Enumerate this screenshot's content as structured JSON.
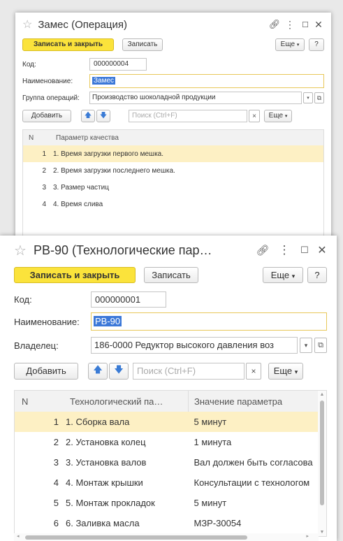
{
  "win1": {
    "title": "Замес (Операция)",
    "save_close": "Записать и закрыть",
    "save": "Записать",
    "more": "Еще",
    "help": "?",
    "code_label": "Код:",
    "code_value": "000000004",
    "name_label": "Наименование:",
    "name_value": "Замес",
    "group_label": "Группа операций:",
    "group_value": "Производство шоколадной продукции",
    "add": "Добавить",
    "search_placeholder": "Поиск (Ctrl+F)",
    "clear": "×",
    "more2": "Еще",
    "col_n": "N",
    "col_param": "Параметр качества",
    "rows": [
      {
        "n": "1",
        "param": "1. Время загрузки первого мешка."
      },
      {
        "n": "2",
        "param": "2. Время загрузки последнего мешка."
      },
      {
        "n": "3",
        "param": "3. Размер частиц"
      },
      {
        "n": "4",
        "param": "4. Время слива"
      }
    ]
  },
  "win2": {
    "title": "РВ-90 (Технологические пар…",
    "save_close": "Записать и закрыть",
    "save": "Записать",
    "more": "Еще",
    "help": "?",
    "code_label": "Код:",
    "code_value": "000000001",
    "name_label": "Наименование:",
    "name_value": "РВ-90",
    "owner_label": "Владелец:",
    "owner_value": "186-0000 Редуктор высокого давления воз",
    "add": "Добавить",
    "search_placeholder": "Поиск (Ctrl+F)",
    "clear": "×",
    "more2": "Еще",
    "col_n": "N",
    "col_param": "Технологический па…",
    "col_value": "Значение параметра",
    "rows": [
      {
        "n": "1",
        "param": "1. Сборка вала",
        "value": "5 минут"
      },
      {
        "n": "2",
        "param": "2. Установка колец",
        "value": "1 минута"
      },
      {
        "n": "3",
        "param": "3. Установка валов",
        "value": "Вал должен быть согласова"
      },
      {
        "n": "4",
        "param": "4. Монтаж крышки",
        "value": "Консультации с технологом"
      },
      {
        "n": "5",
        "param": "5. Монтаж прокладок",
        "value": "5 минут"
      },
      {
        "n": "6",
        "param": "6. Заливка масла",
        "value": "МЗР-30054"
      }
    ]
  }
}
